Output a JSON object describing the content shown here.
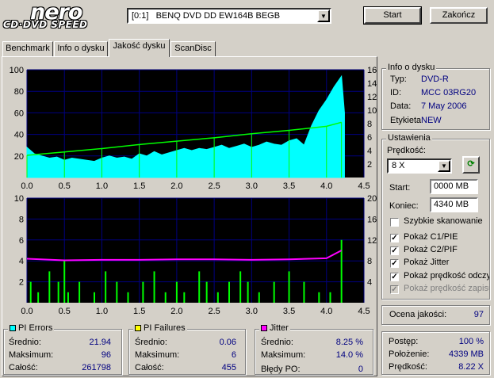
{
  "logo": {
    "brand": "nero",
    "product": "CD·DVD SPEED"
  },
  "drive": {
    "value": "[0:1]   BENQ DVD DD EW164B BEGB"
  },
  "buttons": {
    "start": "Start",
    "close": "Zakończ"
  },
  "tabs": [
    {
      "label": "Benchmark"
    },
    {
      "label": "Info o dysku"
    },
    {
      "label": "Jakość dysku",
      "active": true
    },
    {
      "label": "ScanDisc"
    }
  ],
  "disc_info": {
    "title": "Info o dysku",
    "type_label": "Typ:",
    "type_value": "DVD-R",
    "id_label": "ID:",
    "id_value": "MCC 03RG20",
    "date_label": "Data:",
    "date_value": "7 May 2006",
    "label_label": "Etykieta",
    "label_value": "NEW"
  },
  "settings": {
    "title": "Ustawienia",
    "speed_label": "Prędkość:",
    "speed_value": "8 X",
    "start_label": "Start:",
    "start_value": "0000 MB",
    "end_label": "Koniec:",
    "end_value": "4340 MB",
    "quick_scan": {
      "label": "Szybkie skanowanie",
      "checked": false
    },
    "show_c1": {
      "label": "Pokaż C1/PIE",
      "checked": true
    },
    "show_c2": {
      "label": "Pokaż C2/PIF",
      "checked": true
    },
    "show_jitter": {
      "label": "Pokaż Jitter",
      "checked": true
    },
    "show_read": {
      "label": "Pokaż prędkość odczytu",
      "checked": true
    },
    "show_write": {
      "label": "Pokaż prędkość zapisu",
      "checked": false,
      "disabled": true
    }
  },
  "quality": {
    "label": "Ocena jakości:",
    "value": "97"
  },
  "progress": {
    "progress_label": "Postęp:",
    "progress_value": "100 %",
    "position_label": "Położenie:",
    "position_value": "4339 MB",
    "speed_label": "Prędkość:",
    "speed_value": "8.22 X"
  },
  "pi_errors": {
    "title": "PI Errors",
    "color": "#00ffff",
    "avg_label": "Średnio:",
    "avg": "21.94",
    "max_label": "Maksimum:",
    "max": "96",
    "total_label": "Całość:",
    "total": "261798"
  },
  "pi_failures": {
    "title": "PI Failures",
    "color": "#ffff00",
    "avg_label": "Średnio:",
    "avg": "0.06",
    "max_label": "Maksimum:",
    "max": "6",
    "total_label": "Całość:",
    "total": "455"
  },
  "jitter": {
    "title": "Jitter",
    "color": "#ff00ff",
    "avg_label": "Średnio:",
    "avg": "8.25 %",
    "max_label": "Maksimum:",
    "max": "14.0 %",
    "po_label": "Błędy PO:",
    "po": "0"
  },
  "chart_data": [
    {
      "type": "area",
      "name": "PI Errors / read speed",
      "x_ticks": [
        "0.0",
        "0.5",
        "1.0",
        "1.5",
        "2.0",
        "2.5",
        "3.0",
        "3.5",
        "4.0",
        "4.5"
      ],
      "xlim": [
        0,
        4.5
      ],
      "y_left_ticks": [
        "100",
        "80",
        "60",
        "40",
        "20"
      ],
      "ylim_left": [
        0,
        100
      ],
      "y_right_ticks": [
        "16",
        "14",
        "12",
        "10",
        "8",
        "6",
        "4",
        "2"
      ],
      "ylim_right": [
        0,
        16
      ],
      "pi_errors": {
        "color": "#00ffff",
        "x": [
          0.0,
          0.1,
          0.2,
          0.3,
          0.4,
          0.5,
          0.6,
          0.7,
          0.8,
          0.9,
          1.0,
          1.1,
          1.2,
          1.3,
          1.4,
          1.5,
          1.6,
          1.7,
          1.8,
          1.9,
          2.0,
          2.1,
          2.2,
          2.3,
          2.4,
          2.5,
          2.6,
          2.7,
          2.8,
          2.9,
          3.0,
          3.1,
          3.2,
          3.3,
          3.4,
          3.5,
          3.6,
          3.7,
          3.8,
          3.9,
          4.0,
          4.1,
          4.2,
          4.24
        ],
        "y": [
          28,
          22,
          20,
          18,
          19,
          16,
          18,
          17,
          16,
          15,
          18,
          20,
          18,
          19,
          17,
          22,
          20,
          24,
          21,
          23,
          25,
          27,
          25,
          27,
          26,
          28,
          30,
          27,
          29,
          31,
          28,
          30,
          33,
          31,
          30,
          34,
          36,
          30,
          48,
          62,
          72,
          84,
          94,
          60
        ]
      },
      "read_speed": {
        "color": "#00ff00",
        "x": [
          0.0,
          0.5,
          1.0,
          1.5,
          2.0,
          2.5,
          3.0,
          3.5,
          4.0,
          4.2
        ],
        "y": [
          3.3,
          3.8,
          4.3,
          4.9,
          5.4,
          5.9,
          6.5,
          7.0,
          7.6,
          8.2
        ]
      }
    },
    {
      "type": "line",
      "name": "PI Failures / Jitter",
      "x_ticks": [
        "0.0",
        "0.5",
        "1.0",
        "1.5",
        "2.0",
        "2.5",
        "3.0",
        "3.5",
        "4.0",
        "4.5"
      ],
      "xlim": [
        0,
        4.5
      ],
      "y_left_ticks": [
        "10",
        "8",
        "6",
        "4",
        "2"
      ],
      "ylim_left": [
        0,
        10
      ],
      "y_right_ticks": [
        "20",
        "16",
        "12",
        "8",
        "4"
      ],
      "ylim_right": [
        0,
        20
      ],
      "pi_failures": {
        "color": "#00ff00",
        "x": [
          0.05,
          0.15,
          0.3,
          0.42,
          0.5,
          0.55,
          0.7,
          0.9,
          1.05,
          1.2,
          1.35,
          1.55,
          1.7,
          1.85,
          2.0,
          2.1,
          2.3,
          2.4,
          2.55,
          2.7,
          2.85,
          2.95,
          3.1,
          3.3,
          3.5,
          3.7,
          3.9,
          4.05,
          4.2
        ],
        "y": [
          2,
          1,
          3,
          2,
          4,
          1,
          2,
          1,
          3,
          2,
          1,
          2,
          3,
          1,
          2,
          1,
          3,
          2,
          1,
          2,
          3,
          2,
          1,
          2,
          3,
          2,
          1,
          1,
          6
        ]
      },
      "jitter": {
        "color": "#ff00ff",
        "x": [
          0.0,
          0.5,
          1.0,
          1.5,
          2.0,
          2.5,
          3.0,
          3.5,
          4.0,
          4.2
        ],
        "y": [
          8.4,
          8.1,
          8.2,
          8.2,
          8.3,
          8.3,
          8.2,
          8.3,
          8.5,
          10.0
        ]
      }
    }
  ]
}
